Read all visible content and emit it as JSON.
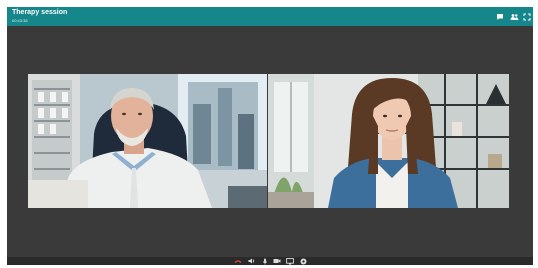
{
  "window": {
    "title": "Therapy session",
    "timer": "00:43:38"
  },
  "toolbar": {
    "icons": [
      "chat-icon",
      "participants-icon",
      "fullscreen-icon"
    ]
  },
  "participants": [
    {
      "role": "therapist"
    },
    {
      "role": "patient"
    }
  ],
  "controls": {
    "icons": [
      "end-call-icon",
      "speaker-icon",
      "microphone-icon",
      "camera-icon",
      "screen-share-icon",
      "settings-icon"
    ],
    "accent": "#e0433a"
  },
  "colors": {
    "titlebar": "#15868a",
    "background": "#3a3a3a",
    "controlbar": "#2a2a2a"
  }
}
